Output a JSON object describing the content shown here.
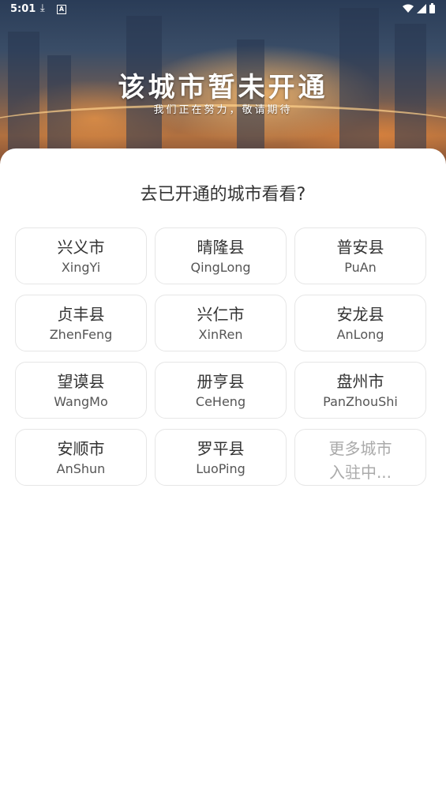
{
  "status_bar": {
    "time": "5:01",
    "download_icon": "download-icon",
    "a_icon": "A",
    "wifi_icon": "wifi-icon",
    "signal_icon": "signal-icon",
    "battery_icon": "battery-icon"
  },
  "banner": {
    "title": "该城市暂未开通",
    "subtitle": "我们正在努力，敬请期待"
  },
  "section": {
    "title": "去已开通的城市看看?"
  },
  "cities": [
    {
      "name": "兴义市",
      "pinyin": "XingYi"
    },
    {
      "name": "晴隆县",
      "pinyin": "QingLong"
    },
    {
      "name": "普安县",
      "pinyin": "PuAn"
    },
    {
      "name": "贞丰县",
      "pinyin": "ZhenFeng"
    },
    {
      "name": "兴仁市",
      "pinyin": "XinRen"
    },
    {
      "name": "安龙县",
      "pinyin": "AnLong"
    },
    {
      "name": "望谟县",
      "pinyin": "WangMo"
    },
    {
      "name": "册亨县",
      "pinyin": "CeHeng"
    },
    {
      "name": "盘州市",
      "pinyin": "PanZhouShi"
    },
    {
      "name": "安顺市",
      "pinyin": "AnShun"
    },
    {
      "name": "罗平县",
      "pinyin": "LuoPing"
    }
  ],
  "more_card": {
    "line1": "更多城市",
    "line2": "入驻中..."
  }
}
